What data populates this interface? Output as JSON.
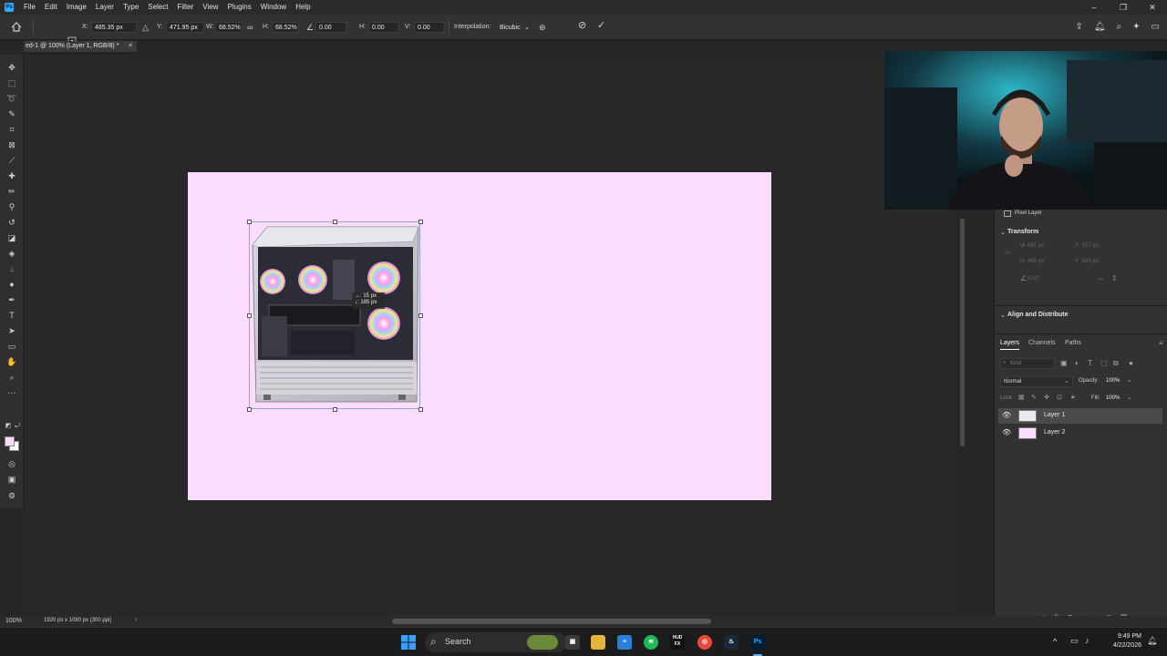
{
  "app": {
    "logo_text": "Ps",
    "menu": [
      "File",
      "Edit",
      "Image",
      "Layer",
      "Type",
      "Select",
      "Filter",
      "View",
      "Plugins",
      "Window",
      "Help"
    ],
    "window_controls": [
      "–",
      "❐",
      "✕"
    ]
  },
  "options_bar": {
    "x_label": "X:",
    "x_value": "485.35 px",
    "y_label": "Y:",
    "y_value": "471.95 px",
    "w_label": "W:",
    "w_value": "68.52%",
    "h_label": "H:",
    "h_value": "68.52%",
    "angle_value": "0.00",
    "hskew_label": "H:",
    "hskew_value": "0.00",
    "vskew_label": "V:",
    "vskew_value": "0.00",
    "interpolation_label": "Interpolation:",
    "interpolation_value": "Bicubic"
  },
  "document": {
    "tab_title": "ed-1 @ 100% (Layer 1, RGB/8) *",
    "canvas_color": "#fcdcfc"
  },
  "transform_tooltip": {
    "line1": "→: 15 px",
    "line2": "↓: 185 px"
  },
  "properties": {
    "layer_type": "Pixel Layer",
    "transform_title": "Transform",
    "w_label": "W",
    "w_value": "657 px",
    "x_label": "X",
    "x_value": "557 px",
    "h_label": "H",
    "h_value": "480 px",
    "y_label": "Y",
    "y_value": "540 px",
    "angle_value": "0.00°",
    "align_title": "Align and Distribute"
  },
  "layers_panel": {
    "tabs": [
      "Layers",
      "Channels",
      "Paths"
    ],
    "filter_placeholder": "Kind",
    "blend_mode": "Normal",
    "opacity_label": "Opacity:",
    "opacity_value": "100%",
    "lock_label": "Lock:",
    "fill_label": "Fill:",
    "fill_value": "100%",
    "layers": [
      {
        "name": "Layer 1",
        "selected": true
      },
      {
        "name": "Layer 2",
        "selected": false
      }
    ]
  },
  "status_bar": {
    "zoom": "100%",
    "doc_info": "1920 px x 1080 px (300 ppi)"
  },
  "taskbar": {
    "search_label": "Search",
    "time": "9:49 PM",
    "date": "4/22/2026",
    "hud_label": "HUD FX"
  }
}
